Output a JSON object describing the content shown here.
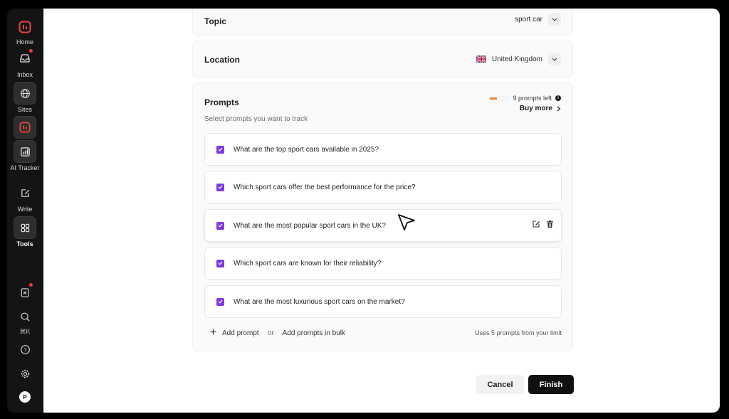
{
  "sidebar": {
    "items": [
      {
        "label": "",
        "icon": "brand-logo-icon"
      },
      {
        "label": "Home",
        "icon": "inbox-tray-icon"
      },
      {
        "label": "Inbox",
        "icon": "globe-icon"
      },
      {
        "label": "Sites",
        "icon": "tracker-logo-icon"
      },
      {
        "label": "AI Tracker",
        "icon": "chart-icon"
      },
      {
        "label": "Write",
        "icon": "edit-icon"
      },
      {
        "label": "Tools",
        "icon": "grid-icon"
      }
    ],
    "home_label": "Home",
    "inbox_label": "Inbox",
    "sites_label": "Sites",
    "ai_tracker_label": "AI Tracker",
    "write_label": "Write",
    "tools_label": "Tools",
    "shortcut": "⌘K",
    "avatar_initial": "P"
  },
  "topic": {
    "label": "Topic",
    "value": "sport car"
  },
  "location": {
    "label": "Location",
    "value": "United Kingdom"
  },
  "prompts": {
    "title": "Prompts",
    "subtitle": "Select prompts you want to track",
    "remaining": "9 prompts left",
    "remaining_fraction": 0.35,
    "buy_more": "Buy more",
    "items": [
      "What are the top sport cars available in 2025?",
      "Which sport cars offer the best performance for the price?",
      "What are the most popular sport cars in the UK?",
      "Which sport cars are known for their reliability?",
      "What are the most luxurious sport cars on the market?"
    ],
    "add_prompt": "Add prompt",
    "or": "or",
    "add_bulk": "Add prompts in bulk",
    "usage": "Uses 5 prompts from your limit"
  },
  "actions": {
    "cancel": "Cancel",
    "finish": "Finish"
  },
  "colors": {
    "accent": "#7c3ae6",
    "notification": "#ef3b3b",
    "brand": "#e8453c",
    "progress": "#f08a3a"
  }
}
